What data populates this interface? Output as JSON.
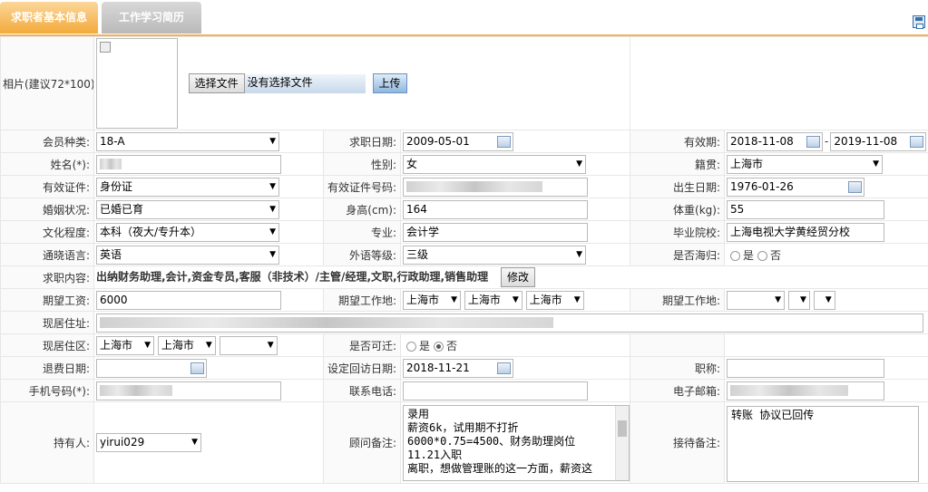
{
  "tabs": {
    "basic": "求职者基本信息",
    "work": "工作学习简历"
  },
  "photo": {
    "label": "相片(建议72*100):",
    "choose_button": "选择文件",
    "no_file": "没有选择文件",
    "upload_button": "上传"
  },
  "fields": {
    "member_type": {
      "label": "会员种类:",
      "value": "18-A"
    },
    "apply_date": {
      "label": "求职日期:",
      "value": "2009-05-01"
    },
    "validity": {
      "label": "有效期:",
      "from": "2018-11-08",
      "sep": "-",
      "to": "2019-11-08"
    },
    "name": {
      "label": "姓名(*):"
    },
    "gender": {
      "label": "性别:",
      "value": "女"
    },
    "native": {
      "label": "籍贯:",
      "value": "上海市"
    },
    "id_type": {
      "label": "有效证件:",
      "value": "身份证"
    },
    "id_number": {
      "label": "有效证件号码:"
    },
    "birth": {
      "label": "出生日期:",
      "value": "1976-01-26"
    },
    "marital": {
      "label": "婚姻状况:",
      "value": "已婚已育"
    },
    "height": {
      "label": "身高(cm):",
      "value": "164"
    },
    "weight": {
      "label": "体重(kg):",
      "value": "55"
    },
    "education": {
      "label": "文化程度:",
      "value": "本科（夜大/专升本）"
    },
    "major": {
      "label": "专业:",
      "value": "会计学"
    },
    "school": {
      "label": "毕业院校:",
      "value": "上海电视大学黄经贸分校"
    },
    "language": {
      "label": "通晓语言:",
      "value": "英语"
    },
    "lang_level": {
      "label": "外语等级:",
      "value": "三级"
    },
    "overseas": {
      "label": "是否海归:",
      "yes": "是",
      "no": "否"
    },
    "job_content": {
      "label": "求职内容:",
      "value": "出纳财务助理,会计,资金专员,客服（非技术）/主管/经理,文职,行政助理,销售助理",
      "edit_button": "修改"
    },
    "salary": {
      "label": "期望工资:",
      "value": "6000"
    },
    "work_place": {
      "label": "期望工作地:",
      "p1": "上海市",
      "p2": "上海市",
      "p3": "上海市"
    },
    "work_place2": {
      "label": "期望工作地:"
    },
    "address": {
      "label": "现居住址:"
    },
    "district": {
      "label": "现居住区:",
      "p1": "上海市",
      "p2": "上海市"
    },
    "relocate": {
      "label": "是否可迁:",
      "yes": "是",
      "no": "否"
    },
    "refund_date": {
      "label": "退费日期:"
    },
    "callback_date": {
      "label": "设定回访日期:",
      "value": "2018-11-21"
    },
    "title": {
      "label": "职称:"
    },
    "mobile": {
      "label": "手机号码(*):"
    },
    "phone": {
      "label": "联系电话:"
    },
    "email": {
      "label": "电子邮箱:"
    },
    "owner": {
      "label": "持有人:",
      "value": "yirui029"
    },
    "consultant_note": {
      "label": "顾问备注:",
      "value": "录用\n薪资6k，试用期不打折\n6000*0.75=4500、财务助理岗位\n11.21入职\n离职，想做管理账的这一方面，薪资这"
    },
    "reception_note": {
      "label": "接待备注:",
      "value": "转账 协议已回传"
    }
  }
}
